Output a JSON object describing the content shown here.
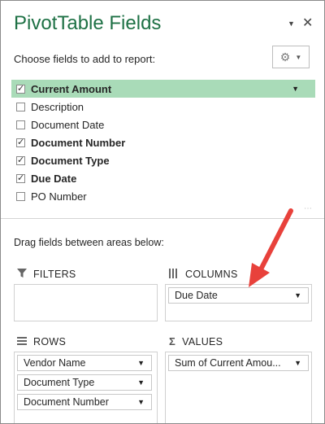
{
  "pane": {
    "title": "PivotTable Fields",
    "choose_label": "Choose fields to add to report:",
    "drag_label": "Drag fields between areas below:"
  },
  "fields": [
    {
      "label": "Current Amount",
      "checked": true,
      "selected": true
    },
    {
      "label": "Description",
      "checked": false,
      "selected": false
    },
    {
      "label": "Document Date",
      "checked": false,
      "selected": false
    },
    {
      "label": "Document Number",
      "checked": true,
      "selected": false
    },
    {
      "label": "Document Type",
      "checked": true,
      "selected": false
    },
    {
      "label": "Due Date",
      "checked": true,
      "selected": false
    },
    {
      "label": "PO Number",
      "checked": false,
      "selected": false
    }
  ],
  "areas": {
    "filters": {
      "label": "FILTERS",
      "items": []
    },
    "columns": {
      "label": "COLUMNS",
      "items": [
        "Due Date"
      ]
    },
    "rows": {
      "label": "ROWS",
      "items": [
        "Vendor Name",
        "Document Type",
        "Document Number"
      ]
    },
    "values": {
      "label": "VALUES",
      "items": [
        "Sum of Current Amou..."
      ]
    }
  },
  "icons": {
    "chevron": "chevron-down-icon",
    "close": "close-icon",
    "gear": "gear-icon",
    "filter": "filter-icon",
    "columns": "columns-icon",
    "rows": "rows-icon",
    "values": "sigma-icon"
  },
  "colors": {
    "title": "#1e7145",
    "selected_row": "#a9dbb8",
    "arrow": "#e8413b"
  }
}
